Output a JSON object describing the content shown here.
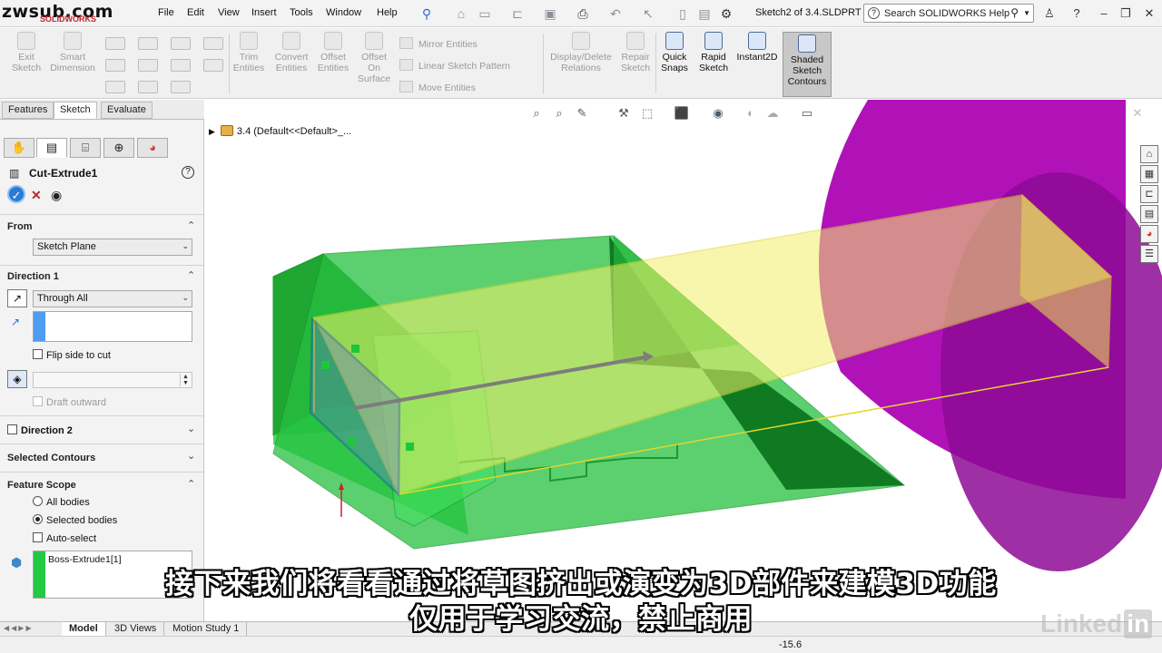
{
  "watermark": {
    "site": "zwsub.com",
    "brand": "SOLIDWORKS"
  },
  "menu": [
    "File",
    "Edit",
    "View",
    "Insert",
    "Tools",
    "Window",
    "Help"
  ],
  "document_title": "Sketch2 of 3.4.SLDPRT *",
  "search": {
    "placeholder": "Search SOLIDWORKS Help"
  },
  "command_manager": {
    "large_buttons": [
      {
        "label": "Exit Sketch",
        "enabled": false
      },
      {
        "label": "Smart Dimension",
        "enabled": false
      },
      {
        "label": "Trim Entities",
        "enabled": false
      },
      {
        "label": "Convert Entities",
        "enabled": false
      },
      {
        "label": "Offset Entities",
        "enabled": false
      },
      {
        "label": "Offset On Surface",
        "enabled": false
      }
    ],
    "small_buttons": [
      "Mirror Entities",
      "Linear Sketch Pattern",
      "Move Entities"
    ],
    "right_buttons": [
      {
        "label": "Display/Delete Relations",
        "enabled": false
      },
      {
        "label": "Repair Sketch",
        "enabled": false
      },
      {
        "label": "Quick Snaps",
        "enabled": true
      },
      {
        "label": "Rapid Sketch",
        "enabled": true
      },
      {
        "label": "Instant2D",
        "enabled": true
      },
      {
        "label": "Shaded Sketch Contours",
        "enabled": true,
        "pressed": true
      }
    ]
  },
  "tabs": [
    "Features",
    "Sketch",
    "Evaluate"
  ],
  "active_tab": "Sketch",
  "feature_tree_root": "3.4  (Default<<Default>_...",
  "property_manager": {
    "title": "Cut-Extrude1",
    "from": {
      "title": "From",
      "value": "Sketch Plane"
    },
    "direction1": {
      "title": "Direction 1",
      "end_condition": "Through All",
      "flip_side_label": "Flip side to cut",
      "draft_label": "Draft outward"
    },
    "direction2": {
      "title": "Direction 2"
    },
    "selected_contours": {
      "title": "Selected Contours"
    },
    "feature_scope": {
      "title": "Feature Scope",
      "options": [
        "All bodies",
        "Selected bodies"
      ],
      "selected_option": "Selected bodies",
      "auto_select_label": "Auto-select",
      "bodies": [
        "Boss-Extrude1[1]"
      ]
    }
  },
  "bottom_tabs": [
    "Model",
    "3D Views",
    "Motion Study 1"
  ],
  "active_bottom_tab": "Model",
  "status_value": "-15.6",
  "subtitles": {
    "line1": "接下来我们将看看通过将草图挤出或演变为3D部件来建模3D功能",
    "line2": "仅用于学习交流，禁止商用"
  },
  "brand_watermark": {
    "text": "Linked",
    "suffix": "in"
  },
  "colors": {
    "part_green": "#22c43a",
    "cut_preview": "#f3f06a",
    "cylinder_magenta": "#b012b8",
    "sketch_blue": "#1b2fd0",
    "ok_blue": "#2b7bd6"
  }
}
